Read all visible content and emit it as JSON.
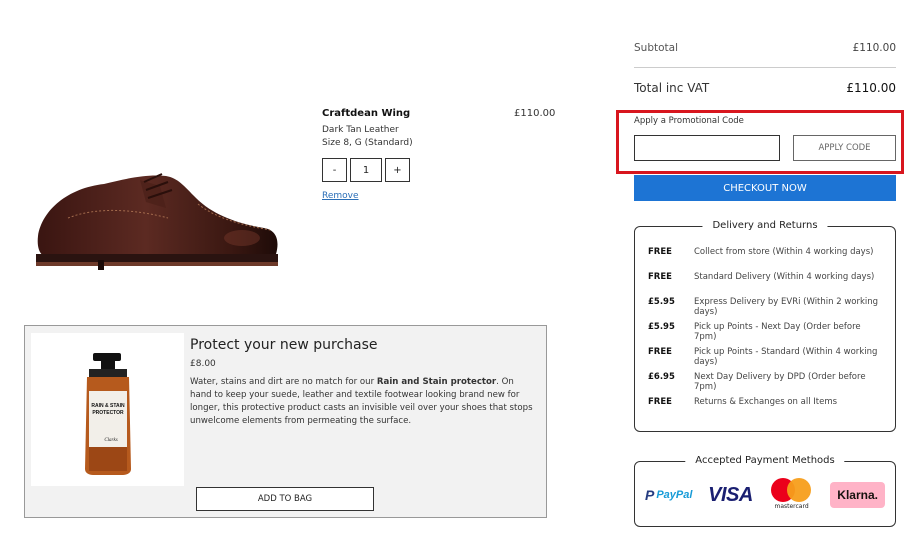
{
  "product": {
    "name": "Craftdean Wing",
    "color": "Dark Tan Leather",
    "size": "Size 8, G (Standard)",
    "price": "£110.00",
    "qty_minus": "-",
    "qty_value": "1",
    "qty_plus": "+",
    "remove_label": "Remove"
  },
  "protect": {
    "title": "Protect your new purchase",
    "price": "£8.00",
    "desc_before": "Water, stains and dirt are no match for our ",
    "desc_bold": "Rain and Stain protector",
    "desc_after": ". On hand to keep your suede, leather and textile footwear looking brand new for longer, this protective product casts an invisible veil over your shoes that stops unwelcome elements from permeating the surface.",
    "add_button": "ADD TO BAG",
    "bottle_label_1": "RAIN & STAIN",
    "bottle_label_2": "PROTECTOR",
    "bottle_brand": "Clarks"
  },
  "summary": {
    "subtotal_label": "Subtotal",
    "subtotal_value": "£110.00",
    "total_label": "Total inc VAT",
    "total_value": "£110.00",
    "promo_label": "Apply a Promotional Code",
    "promo_placeholder": "",
    "apply_button": "APPLY CODE",
    "checkout_button": "CHECKOUT NOW",
    "highlight_color": "#d8161e",
    "checkout_color": "#1d74d4"
  },
  "delivery": {
    "title": "Delivery and Returns",
    "rows": [
      {
        "price": "FREE",
        "desc": "Collect from store (Within 4 working days)"
      },
      {
        "price": "FREE",
        "desc": "Standard Delivery (Within 4 working days)"
      },
      {
        "price": "£5.95",
        "desc": "Express Delivery by EVRi (Within 2 working days)"
      },
      {
        "price": "£5.95",
        "desc": "Pick up Points - Next Day (Order before 7pm)"
      },
      {
        "price": "FREE",
        "desc": "Pick up Points - Standard (Within 4 working days)"
      },
      {
        "price": "£6.95",
        "desc": "Next Day Delivery by DPD (Order before 7pm)"
      },
      {
        "price": "FREE",
        "desc": "Returns & Exchanges on all Items"
      }
    ]
  },
  "payment": {
    "title": "Accepted Payment Methods",
    "methods": [
      "PayPal",
      "VISA",
      "mastercard",
      "Klarna."
    ]
  }
}
